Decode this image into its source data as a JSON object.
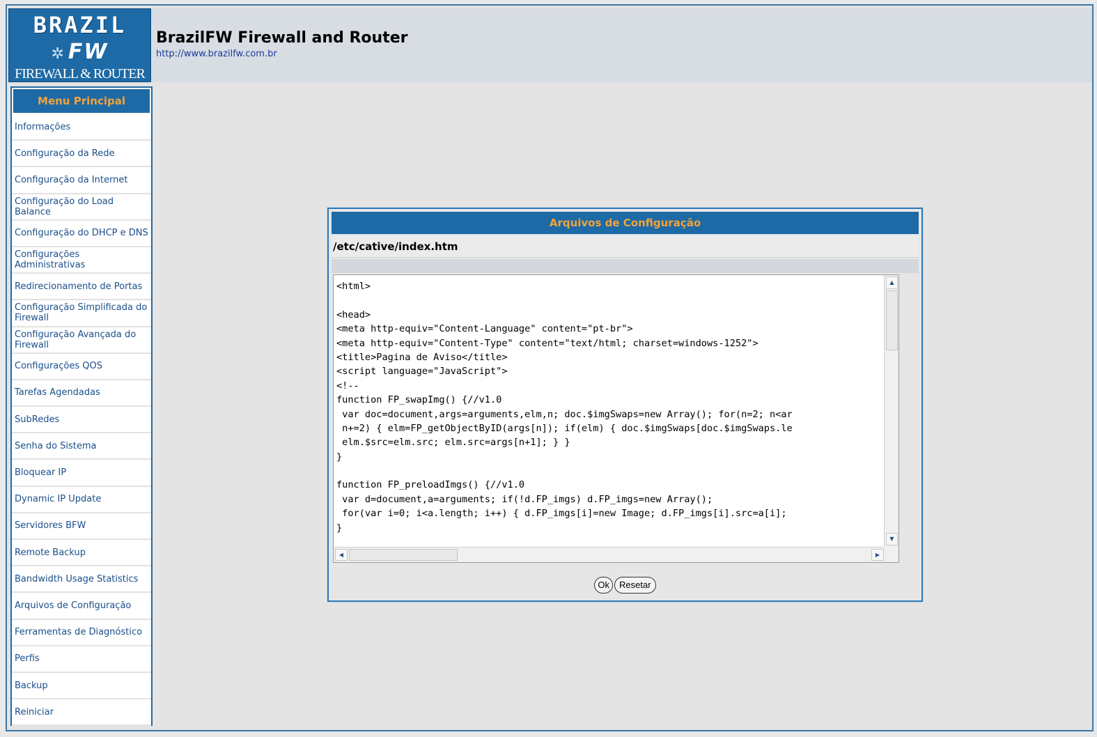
{
  "header": {
    "logo": {
      "line1": "BRAZIL",
      "line2": "FW",
      "line3": "FIREWALL & ROUTER"
    },
    "title": "BrazilFW Firewall and Router",
    "url": "http://www.brazilfw.com.br"
  },
  "sidebar": {
    "title": "Menu Principal",
    "items": [
      {
        "label": "Informações"
      },
      {
        "label": "Configuração da Rede"
      },
      {
        "label": "Configuração da Internet"
      },
      {
        "label": "Configuração do Load Balance"
      },
      {
        "label": "Configuração do DHCP e DNS"
      },
      {
        "label": "Configurações Administrativas"
      },
      {
        "label": "Redirecionamento de Portas"
      },
      {
        "label": "Configuração Simplificada do Firewall"
      },
      {
        "label": "Configuração Avançada do Firewall"
      },
      {
        "label": "Configurações QOS"
      },
      {
        "label": "Tarefas Agendadas"
      },
      {
        "label": "SubRedes"
      },
      {
        "label": "Senha do Sistema"
      },
      {
        "label": "Bloquear IP"
      },
      {
        "label": "Dynamic IP Update"
      },
      {
        "label": "Servidores BFW"
      },
      {
        "label": "Remote Backup"
      },
      {
        "label": "Bandwidth Usage Statistics"
      },
      {
        "label": "Arquivos de Configuração"
      },
      {
        "label": "Ferramentas de Diagnóstico"
      },
      {
        "label": "Perfis"
      },
      {
        "label": "Backup"
      },
      {
        "label": "Reiniciar"
      }
    ]
  },
  "dialog": {
    "title": "Arquivos de Configuração",
    "file_path": "/etc/cative/index.htm",
    "code_lines": [
      "<html>",
      "",
      "<head>",
      "<meta http-equiv=\"Content-Language\" content=\"pt-br\">",
      "<meta http-equiv=\"Content-Type\" content=\"text/html; charset=windows-1252\">",
      "<title>Pagina de Aviso</title>",
      "<script language=\"JavaScript\">",
      "<!--",
      "function FP_swapImg() {//v1.0",
      " var doc=document,args=arguments,elm,n; doc.$imgSwaps=new Array(); for(n=2; n<ar",
      " n+=2) { elm=FP_getObjectByID(args[n]); if(elm) { doc.$imgSwaps[doc.$imgSwaps.le",
      " elm.$src=elm.src; elm.src=args[n+1]; } }",
      "}",
      "",
      "function FP_preloadImgs() {//v1.0",
      " var d=document,a=arguments; if(!d.FP_imgs) d.FP_imgs=new Array();",
      " for(var i=0; i<a.length; i++) { d.FP_imgs[i]=new Image; d.FP_imgs[i].src=a[i];",
      "}",
      ""
    ],
    "ok_label": "Ok",
    "reset_label": "Resetar"
  },
  "colors": {
    "brand_blue": "#1e6aa6",
    "accent_orange": "#f2a33a",
    "link_blue": "#1a4f8a"
  }
}
